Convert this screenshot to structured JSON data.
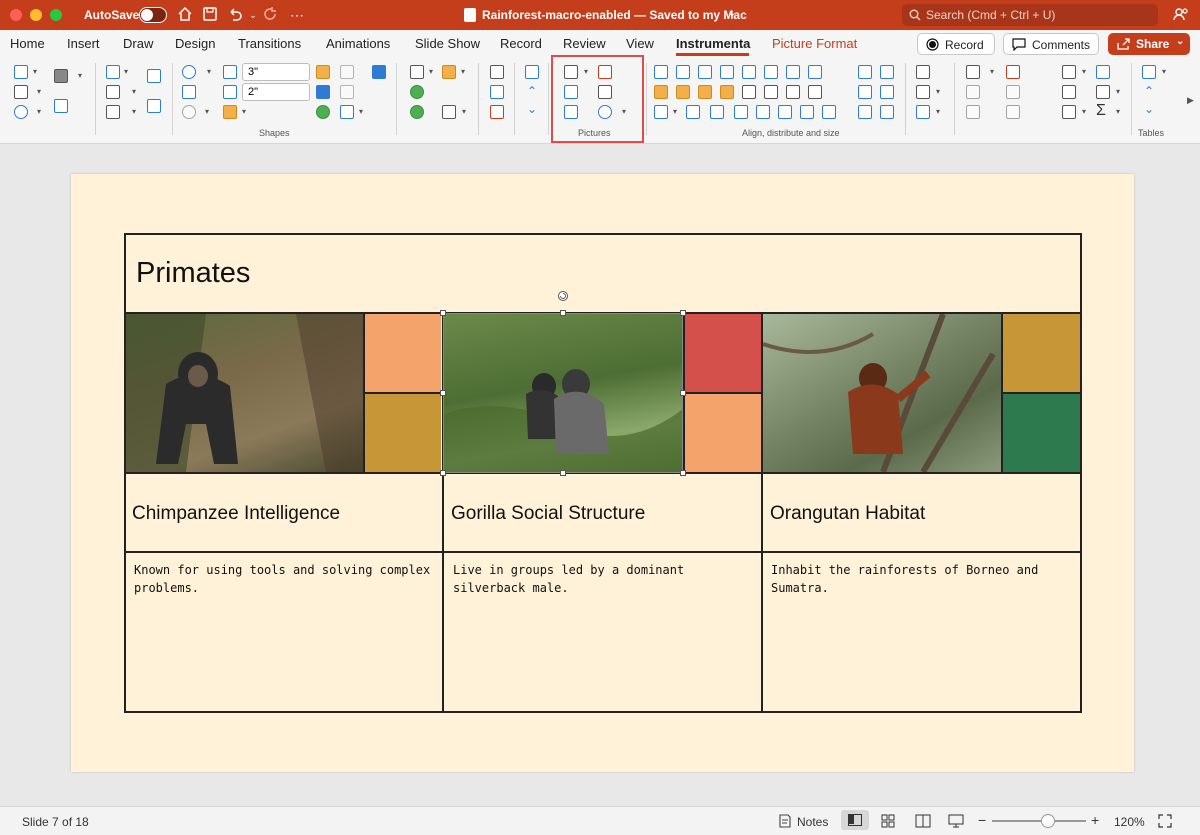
{
  "titlebar": {
    "autosave_label": "AutoSave",
    "doc_title": "Rainforest-macro-enabled — Saved to my Mac",
    "search_placeholder": "Search (Cmd + Ctrl + U)"
  },
  "tabs": [
    {
      "label": "Home"
    },
    {
      "label": "Insert"
    },
    {
      "label": "Draw"
    },
    {
      "label": "Design"
    },
    {
      "label": "Transitions"
    },
    {
      "label": "Animations"
    },
    {
      "label": "Slide Show"
    },
    {
      "label": "Record"
    },
    {
      "label": "Review"
    },
    {
      "label": "View"
    },
    {
      "label": "Instrumenta"
    },
    {
      "label": "Picture Format"
    }
  ],
  "actions": {
    "record_label": "Record",
    "comments_label": "Comments",
    "share_label": "Share"
  },
  "ribbon": {
    "width_value": "3\"",
    "height_value": "2\"",
    "groups": {
      "shapes": "Shapes",
      "pictures": "Pictures",
      "align": "Align, distribute and size",
      "tables": "Tables"
    }
  },
  "slide": {
    "title": "Primates",
    "cards": [
      {
        "title": "Chimpanzee Intelligence",
        "description": "Known for using tools and solving complex problems.",
        "swatches": [
          "#f4a36b",
          "#c79637"
        ]
      },
      {
        "title": "Gorilla Social Structure",
        "description": "Live in groups led by a dominant silverback male.",
        "swatches": [
          "#d4504a",
          "#f4a36b"
        ]
      },
      {
        "title": "Orangutan Habitat",
        "description": "Inhabit the rainforests of Borneo and Sumatra.",
        "swatches": [
          "#c79637",
          "#2e7a4f"
        ]
      }
    ]
  },
  "status": {
    "slide_indicator": "Slide 7 of 18",
    "notes_label": "Notes",
    "zoom": "120%",
    "zoom_level": 0.6
  },
  "colors": {
    "accent": "#c43e1c",
    "slide_bg": "#fff2d8"
  }
}
